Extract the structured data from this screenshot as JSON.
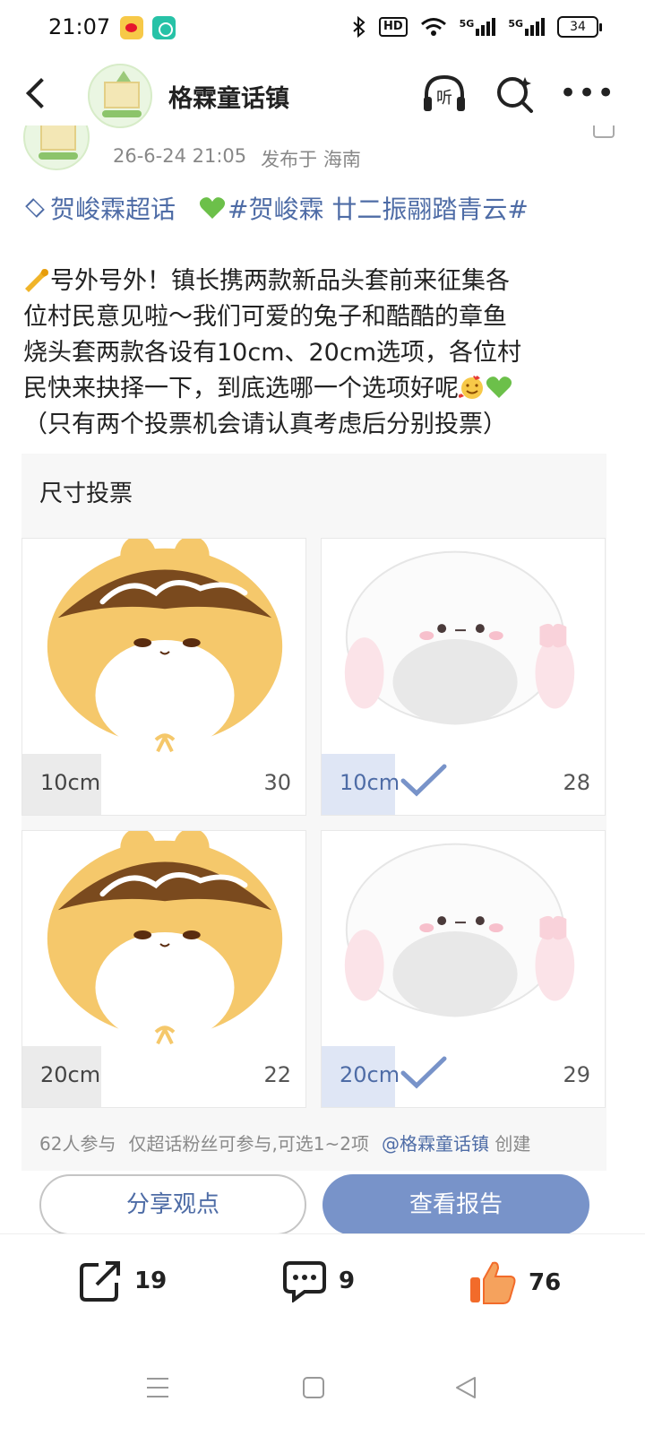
{
  "status_bar": {
    "time": "21:07",
    "network": "5G",
    "network2": "5G",
    "hd": "HD",
    "battery": "34"
  },
  "header": {
    "title": "格霖童话镇",
    "listen_label": "听"
  },
  "post": {
    "date": "26-6-24 21:05",
    "location": "发布于 海南",
    "supertopic": "贺峻霖超话",
    "hashtag": "#贺峻霖 廿二振翮踏青云#",
    "body_lines": [
      "号外号外！镇长携两款新品头套前来征集各",
      "位村民意见啦～我们可爱的兔子和酷酷的章鱼",
      "烧头套两款各设有10cm、20cm选项，各位村",
      "民快来抉择一下，到底选哪一个选项好呢",
      "（只有两个投票机会请认真考虑后分别投票）"
    ]
  },
  "poll": {
    "title": "尺寸投票",
    "options": [
      {
        "label": "10cm",
        "count": "30",
        "image": "takoyaki-bunny-hat",
        "voted": false
      },
      {
        "label": "10cm",
        "count": "28",
        "image": "white-bunny-hat",
        "voted": true
      },
      {
        "label": "20cm",
        "count": "22",
        "image": "takoyaki-bunny-hat",
        "voted": false
      },
      {
        "label": "20cm",
        "count": "29",
        "image": "white-bunny-hat",
        "voted": true
      }
    ],
    "participants": "62人参与",
    "rule": "仅超话粉丝可参与,可选1~2项",
    "creator": "@格霖童话镇",
    "creator_suffix": "创建",
    "share_button": "分享观点",
    "report_button": "查看报告"
  },
  "actions": {
    "shares": "19",
    "comments": "9",
    "likes": "76"
  },
  "colors": {
    "link": "#4e6ca6",
    "report_button": "#7893c9",
    "voted_bar": "#dfe6f5",
    "like": "#f26b2a"
  }
}
